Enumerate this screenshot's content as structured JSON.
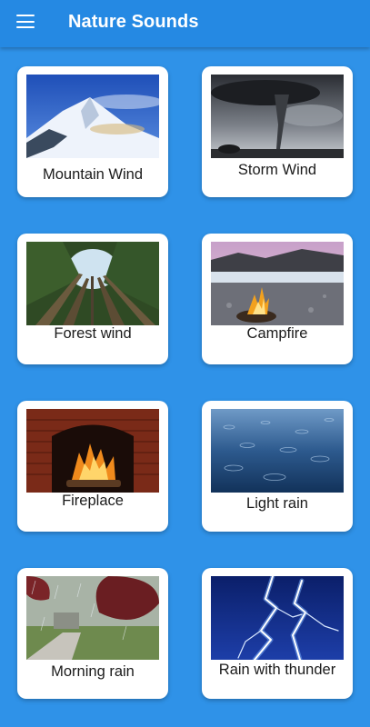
{
  "appbar": {
    "title": "Nature Sounds",
    "menu_icon": "hamburger-menu-icon"
  },
  "colors": {
    "background": "#2f92e8",
    "appbar": "#2589e3",
    "card": "#ffffff"
  },
  "sounds": [
    {
      "label": "Mountain Wind",
      "image": "snowy-mountain"
    },
    {
      "label": "Storm Wind",
      "image": "tornado"
    },
    {
      "label": "Forest wind",
      "image": "forest-canopy"
    },
    {
      "label": "Campfire",
      "image": "campfire-by-river"
    },
    {
      "label": "Fireplace",
      "image": "brick-fireplace"
    },
    {
      "label": "Light rain",
      "image": "rain-on-water"
    },
    {
      "label": "Morning rain",
      "image": "rainy-garden"
    },
    {
      "label": "Rain with thunder",
      "image": "lightning"
    }
  ]
}
